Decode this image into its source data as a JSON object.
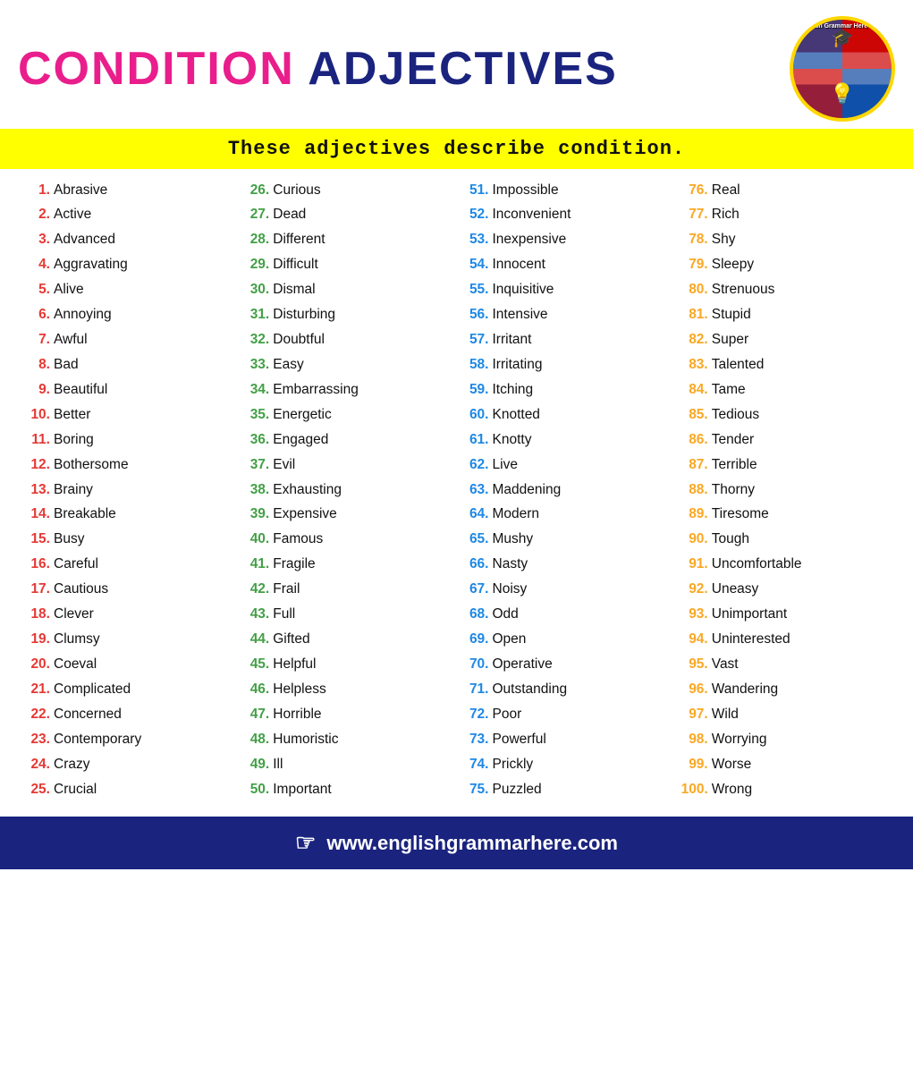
{
  "header": {
    "title_condition": "CONDITION",
    "title_adjectives": "ADJECTIVES",
    "subtitle": "These adjectives describe condition."
  },
  "footer": {
    "url": "www.englishgrammarhere.com"
  },
  "logo": {
    "site": "English Grammar Here .Com"
  },
  "columns": [
    {
      "id": "col1",
      "items": [
        {
          "num": "1.",
          "word": "Abrasive"
        },
        {
          "num": "2.",
          "word": "Active"
        },
        {
          "num": "3.",
          "word": "Advanced"
        },
        {
          "num": "4.",
          "word": "Aggravating"
        },
        {
          "num": "5.",
          "word": "Alive"
        },
        {
          "num": "6.",
          "word": "Annoying"
        },
        {
          "num": "7.",
          "word": "Awful"
        },
        {
          "num": "8.",
          "word": "Bad"
        },
        {
          "num": "9.",
          "word": "Beautiful"
        },
        {
          "num": "10.",
          "word": "Better"
        },
        {
          "num": "11.",
          "word": "Boring"
        },
        {
          "num": "12.",
          "word": "Bothersome"
        },
        {
          "num": "13.",
          "word": "Brainy"
        },
        {
          "num": "14.",
          "word": "Breakable"
        },
        {
          "num": "15.",
          "word": "Busy"
        },
        {
          "num": "16.",
          "word": "Careful"
        },
        {
          "num": "17.",
          "word": "Cautious"
        },
        {
          "num": "18.",
          "word": "Clever"
        },
        {
          "num": "19.",
          "word": "Clumsy"
        },
        {
          "num": "20.",
          "word": "Coeval"
        },
        {
          "num": "21.",
          "word": "Complicated"
        },
        {
          "num": "22.",
          "word": "Concerned"
        },
        {
          "num": "23.",
          "word": "Contemporary"
        },
        {
          "num": "24.",
          "word": "Crazy"
        },
        {
          "num": "25.",
          "word": "Crucial"
        }
      ]
    },
    {
      "id": "col2",
      "items": [
        {
          "num": "26.",
          "word": "Curious"
        },
        {
          "num": "27.",
          "word": "Dead"
        },
        {
          "num": "28.",
          "word": "Different"
        },
        {
          "num": "29.",
          "word": "Difficult"
        },
        {
          "num": "30.",
          "word": "Dismal"
        },
        {
          "num": "31.",
          "word": "Disturbing"
        },
        {
          "num": "32.",
          "word": "Doubtful"
        },
        {
          "num": "33.",
          "word": "Easy"
        },
        {
          "num": "34.",
          "word": "Embarrassing"
        },
        {
          "num": "35.",
          "word": "Energetic"
        },
        {
          "num": "36.",
          "word": "Engaged"
        },
        {
          "num": "37.",
          "word": "Evil"
        },
        {
          "num": "38.",
          "word": "Exhausting"
        },
        {
          "num": "39.",
          "word": "Expensive"
        },
        {
          "num": "40.",
          "word": "Famous"
        },
        {
          "num": "41.",
          "word": "Fragile"
        },
        {
          "num": "42.",
          "word": "Frail"
        },
        {
          "num": "43.",
          "word": "Full"
        },
        {
          "num": "44.",
          "word": "Gifted"
        },
        {
          "num": "45.",
          "word": "Helpful"
        },
        {
          "num": "46.",
          "word": "Helpless"
        },
        {
          "num": "47.",
          "word": "Horrible"
        },
        {
          "num": "48.",
          "word": "Humoristic"
        },
        {
          "num": "49.",
          "word": "Ill"
        },
        {
          "num": "50.",
          "word": "Important"
        }
      ]
    },
    {
      "id": "col3",
      "items": [
        {
          "num": "51.",
          "word": "Impossible"
        },
        {
          "num": "52.",
          "word": "Inconvenient"
        },
        {
          "num": "53.",
          "word": "Inexpensive"
        },
        {
          "num": "54.",
          "word": "Innocent"
        },
        {
          "num": "55.",
          "word": "Inquisitive"
        },
        {
          "num": "56.",
          "word": "Intensive"
        },
        {
          "num": "57.",
          "word": "Irritant"
        },
        {
          "num": "58.",
          "word": "Irritating"
        },
        {
          "num": "59.",
          "word": " Itching"
        },
        {
          "num": "60.",
          "word": "Knotted"
        },
        {
          "num": "61.",
          "word": "Knotty"
        },
        {
          "num": "62.",
          "word": "Live"
        },
        {
          "num": "63.",
          "word": "Maddening"
        },
        {
          "num": "64.",
          "word": "Modern"
        },
        {
          "num": "65.",
          "word": "Mushy"
        },
        {
          "num": "66.",
          "word": "Nasty"
        },
        {
          "num": "67.",
          "word": "Noisy"
        },
        {
          "num": "68.",
          "word": "Odd"
        },
        {
          "num": "69.",
          "word": "Open"
        },
        {
          "num": "70.",
          "word": "Operative"
        },
        {
          "num": "71.",
          "word": "Outstanding"
        },
        {
          "num": "72.",
          "word": "Poor"
        },
        {
          "num": "73.",
          "word": "Powerful"
        },
        {
          "num": "74.",
          "word": "Prickly"
        },
        {
          "num": "75.",
          "word": "Puzzled"
        }
      ]
    },
    {
      "id": "col4",
      "items": [
        {
          "num": "76.",
          "word": "Real"
        },
        {
          "num": "77.",
          "word": "Rich"
        },
        {
          "num": "78.",
          "word": "Shy"
        },
        {
          "num": "79.",
          "word": "Sleepy"
        },
        {
          "num": "80.",
          "word": "Strenuous"
        },
        {
          "num": "81.",
          "word": "Stupid"
        },
        {
          "num": "82.",
          "word": "Super"
        },
        {
          "num": "83.",
          "word": "Talented"
        },
        {
          "num": "84.",
          "word": "Tame"
        },
        {
          "num": "85.",
          "word": " Tedious"
        },
        {
          "num": "86.",
          "word": "Tender"
        },
        {
          "num": "87.",
          "word": "Terrible"
        },
        {
          "num": "88.",
          "word": "Thorny"
        },
        {
          "num": "89.",
          "word": "Tiresome"
        },
        {
          "num": "90.",
          "word": "Tough"
        },
        {
          "num": "91.",
          "word": "Uncomfortable"
        },
        {
          "num": "92.",
          "word": "Uneasy"
        },
        {
          "num": "93.",
          "word": "Unimportant"
        },
        {
          "num": "94.",
          "word": "Uninterested"
        },
        {
          "num": "95.",
          "word": "Vast"
        },
        {
          "num": "96.",
          "word": "Wandering"
        },
        {
          "num": "97.",
          "word": "Wild"
        },
        {
          "num": "98.",
          "word": "Worrying"
        },
        {
          "num": "99.",
          "word": "Worse"
        },
        {
          "num": "100.",
          "word": "Wrong"
        }
      ]
    }
  ]
}
